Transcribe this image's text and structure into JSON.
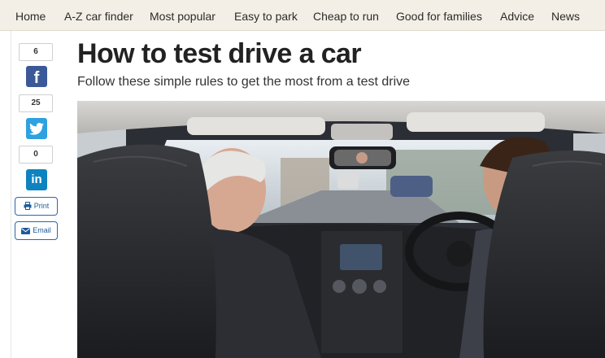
{
  "nav": {
    "items": [
      "Home",
      "A-Z car finder",
      "Most popular",
      "Easy to park",
      "Cheap to run",
      "Good for families",
      "Advice",
      "News"
    ]
  },
  "share": {
    "facebook": {
      "count": "6",
      "icon": "facebook-icon"
    },
    "twitter": {
      "count": "25",
      "icon": "twitter-icon"
    },
    "linkedin": {
      "count": "0",
      "icon": "linkedin-icon"
    },
    "print_label": "Print",
    "email_label": "Email"
  },
  "article": {
    "title": "How to test drive a car",
    "subtitle": "Follow these simple rules to get the most from a test drive"
  },
  "colors": {
    "nav_background": "#f3efe6",
    "facebook": "#3b5998",
    "twitter": "#2fa1e0",
    "linkedin": "#0f83bf",
    "button_accent": "#1f5a9a"
  }
}
